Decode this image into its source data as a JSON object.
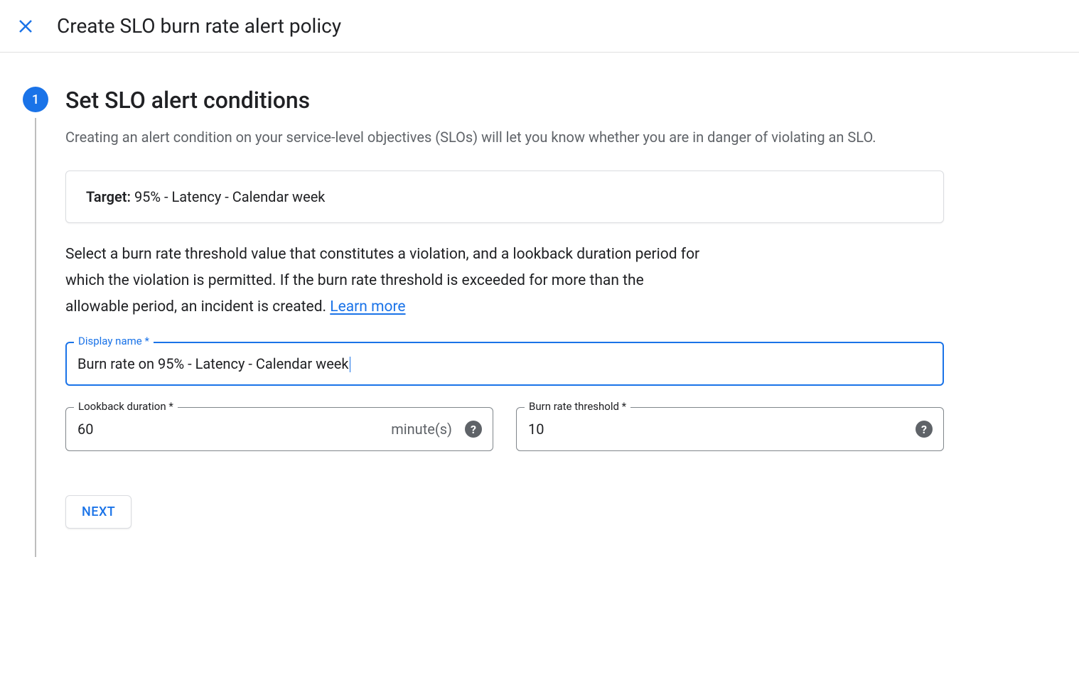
{
  "header": {
    "title": "Create SLO burn rate alert policy"
  },
  "step": {
    "number": "1",
    "title": "Set SLO alert conditions",
    "description": "Creating an alert condition on your service-level objectives (SLOs) will let you know whether you are in danger of violating an SLO.",
    "target_label": "Target:",
    "target_value": " 95% - Latency - Calendar week",
    "instruction_text": "Select a burn rate threshold value that constitutes a violation, and a lookback duration period for which the violation is permitted. If the burn rate threshold is exceeded for more than the allowable period, an incident is created. ",
    "learn_more": "Learn more"
  },
  "fields": {
    "display_name": {
      "label": "Display name *",
      "value": "Burn rate on 95% - Latency - Calendar week"
    },
    "lookback": {
      "label": "Lookback duration *",
      "value": "60",
      "unit": "minute(s)"
    },
    "burn_rate": {
      "label": "Burn rate threshold *",
      "value": "10"
    }
  },
  "buttons": {
    "next": "NEXT"
  }
}
